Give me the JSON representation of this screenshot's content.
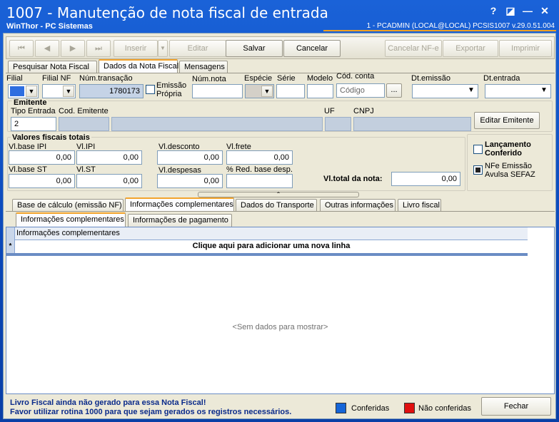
{
  "window": {
    "title": "1007 - Manutenção de nota fiscal de entrada",
    "subtitle": "WinThor - PC Sistemas",
    "sysinfo": "1 - PCADMIN (LOCAL@LOCAL)   PCSIS1007  v.29.0.51.004",
    "buttons": {
      "help": "?",
      "restore": "◪",
      "minimize": "—",
      "close": "✕"
    }
  },
  "toolbar": {
    "first": "⏮",
    "prev": "◀",
    "next": "▶",
    "last": "⏭",
    "inserir": "Inserir",
    "editar": "Editar",
    "salvar": "Salvar",
    "cancelar": "Cancelar",
    "cancelar_nfe": "Cancelar NF-e",
    "exportar": "Exportar",
    "imprimir": "Imprimir"
  },
  "tabs_main": [
    "Pesquisar Nota Fiscal",
    "Dados da Nota Fiscal",
    "Mensagens"
  ],
  "header_fields": {
    "filial": "Filial",
    "filial_nf": "Filial NF",
    "num_transacao_label": "Núm.transação",
    "num_transacao": "1780173",
    "emissao_propria": "Emissão Própria",
    "num_nota": "Núm.nota",
    "especie": "Espécie",
    "serie": "Série",
    "modelo": "Modelo",
    "cod_conta_label": "Cód. conta",
    "cod_conta_placeholder": "Código",
    "dt_emissao": "Dt.emissão",
    "dt_entrada": "Dt.entrada"
  },
  "emitente": {
    "title": "Emitente",
    "tipo_entrada_label": "Tipo Entrada",
    "tipo_entrada": "2",
    "cod_emitente": "Cod. Emitente",
    "uf": "UF",
    "cnpj": "CNPJ",
    "editar": "Editar Emitente"
  },
  "valores": {
    "title": "Valores fiscais totais",
    "base_ipi_label": "Vl.base IPI",
    "base_ipi": "0,00",
    "ipi_label": "Vl.IPI",
    "ipi": "0,00",
    "desconto_label": "Vl.desconto",
    "desconto": "0,00",
    "frete_label": "Vl.frete",
    "frete": "0,00",
    "base_st_label": "Vl.base ST",
    "base_st": "0,00",
    "st_label": "Vl.ST",
    "st": "0,00",
    "despesas_label": "Vl.despesas",
    "despesas": "0,00",
    "red_base_label": "% Red. base desp.",
    "total_label": "Vl.total da nota:",
    "total": "0,00"
  },
  "side": {
    "lancamento": "Lançamento Conferido",
    "nfe_avulsa": "NFe Emissão Avulsa SEFAZ"
  },
  "tabs_sub": [
    "Base de cálculo (emissão NF)",
    "Informações complementares",
    "Dados do Transporte",
    "Outras informações",
    "Livro fiscal"
  ],
  "tabs_info": [
    "Informações complementares",
    "Informações de pagamento"
  ],
  "grid": {
    "column": "Informações complementares",
    "new_row_marker": "*",
    "new_row": "Clique aqui para adicionar uma nova linha",
    "empty": "<Sem dados para mostrar>"
  },
  "footer": {
    "warn1": "Livro Fiscal ainda não gerado para essa Nota Fiscal!",
    "warn2": "Favor utilizar rotina 1000 para que sejam gerados os registros necessários.",
    "conferidas": "Conferidas",
    "nao_conferidas": "Não conferidas",
    "fechar": "Fechar"
  },
  "colors": {
    "conferidas": "#1565d8",
    "nao_conferidas": "#e01010",
    "accent": "#f3a42c"
  }
}
